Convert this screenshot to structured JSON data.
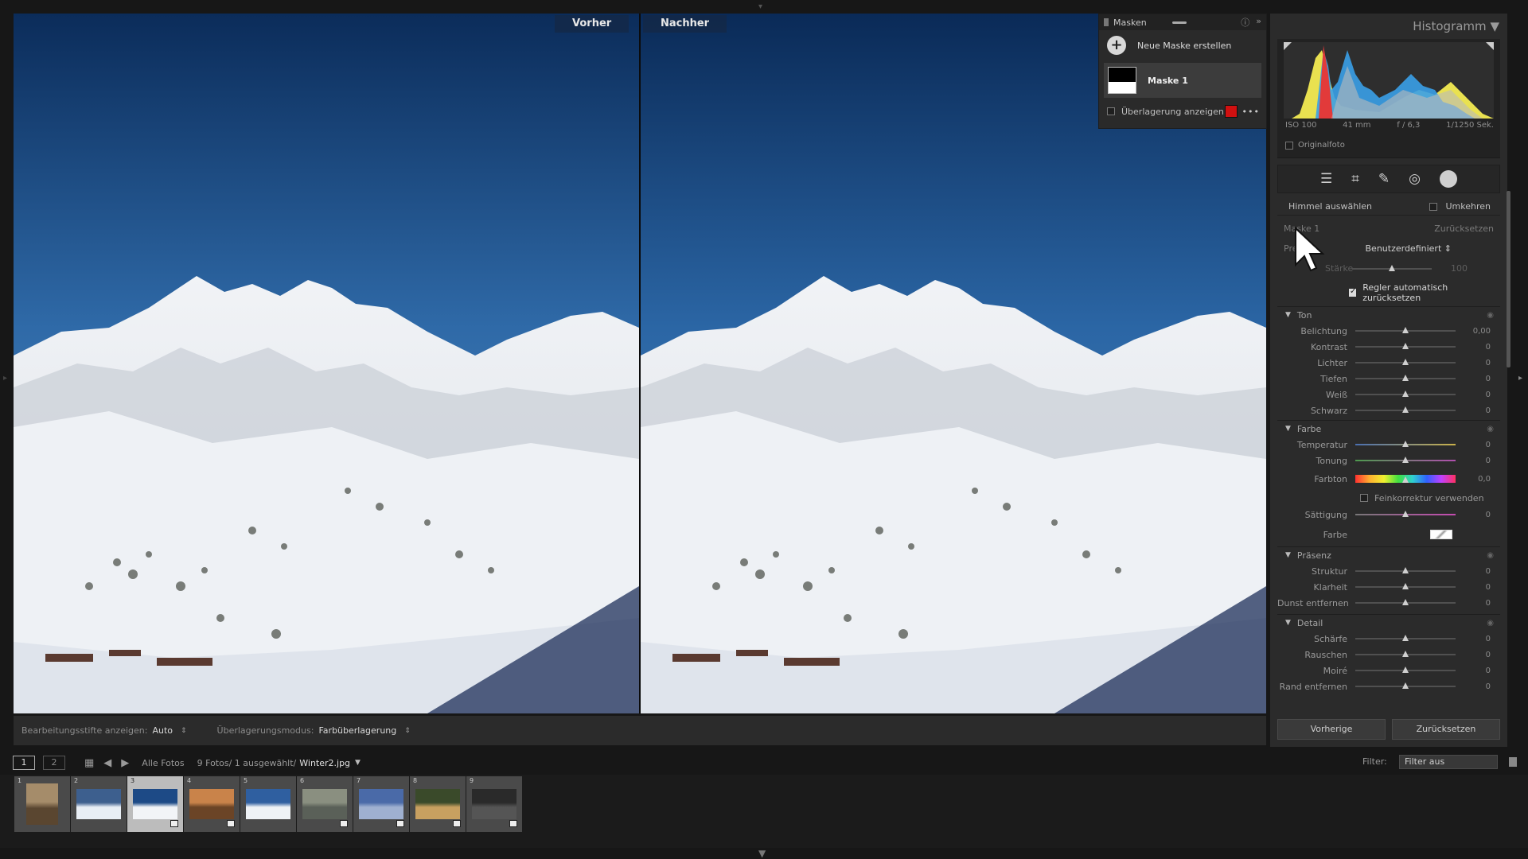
{
  "views": {
    "before_label": "Vorher",
    "after_label": "Nachher"
  },
  "masks_panel": {
    "title": "Masken",
    "new_mask_label": "Neue Maske erstellen",
    "mask_item": "Maske 1",
    "overlay_label": "Überlagerung anzeigen",
    "overlay_color": "#d01010"
  },
  "histogram": {
    "title": "Histogramm",
    "iso": "ISO 100",
    "focal": "41 mm",
    "aperture": "f / 6,3",
    "shutter": "1/1250 Sek.",
    "original_label": "Originalfoto"
  },
  "mask_settings": {
    "select_label": "Himmel auswählen",
    "invert_label": "Umkehren",
    "mask_name": "Maske 1",
    "reset_label": "Zurücksetzen",
    "preset_label": "Pre",
    "preset_value": "Benutzerdefiniert",
    "amount_label": "Stärke",
    "amount_value": "100",
    "auto_reset_label": "Regler automatisch zurücksetzen"
  },
  "sections": {
    "tone": {
      "title": "Ton",
      "sliders": [
        {
          "name": "Belichtung",
          "value": "0,00",
          "pos": 0.5
        },
        {
          "name": "Kontrast",
          "value": "0",
          "pos": 0.5
        },
        {
          "name": "Lichter",
          "value": "0",
          "pos": 0.5
        },
        {
          "name": "Tiefen",
          "value": "0",
          "pos": 0.5
        },
        {
          "name": "Weiß",
          "value": "0",
          "pos": 0.5
        },
        {
          "name": "Schwarz",
          "value": "0",
          "pos": 0.5
        }
      ]
    },
    "color": {
      "title": "Farbe",
      "temperature": {
        "name": "Temperatur",
        "value": "0",
        "pos": 0.5
      },
      "tint": {
        "name": "Tonung",
        "value": "0",
        "pos": 0.5
      },
      "hue": {
        "name": "Farbton",
        "value": "0,0",
        "pos": 0.5
      },
      "fine_label": "Feinkorrektur verwenden",
      "saturation": {
        "name": "Sättigung",
        "value": "0",
        "pos": 0.5
      },
      "color_label": "Farbe"
    },
    "presence": {
      "title": "Präsenz",
      "sliders": [
        {
          "name": "Struktur",
          "value": "0",
          "pos": 0.5
        },
        {
          "name": "Klarheit",
          "value": "0",
          "pos": 0.5
        },
        {
          "name": "Dunst entfernen",
          "value": "0",
          "pos": 0.5
        }
      ]
    },
    "detail": {
      "title": "Detail",
      "sliders": [
        {
          "name": "Schärfe",
          "value": "0",
          "pos": 0.5
        },
        {
          "name": "Rauschen",
          "value": "0",
          "pos": 0.5
        },
        {
          "name": "Moiré",
          "value": "0",
          "pos": 0.5
        },
        {
          "name": "Rand entfernen",
          "value": "0",
          "pos": 0.5
        }
      ]
    }
  },
  "panel_buttons": {
    "previous": "Vorherige",
    "reset": "Zurücksetzen"
  },
  "toolbar": {
    "pins_label": "Bearbeitungsstifte anzeigen:",
    "pins_value": "Auto",
    "overlay_mode_label": "Überlagerungsmodus:",
    "overlay_mode_value": "Farbüberlagerung"
  },
  "filmstrip_header": {
    "monitor1": "1",
    "monitor2": "2",
    "source": "Alle Fotos",
    "count": "9 Fotos/ 1 ausgewählt/",
    "filename": "Winter2.jpg",
    "filter_label": "Filter:",
    "filter_value": "Filter aus"
  },
  "filmstrip": [
    {
      "num": "1",
      "selected": false,
      "colors": [
        "#a58c6a",
        "#5a4630"
      ],
      "badge": false
    },
    {
      "num": "2",
      "selected": false,
      "colors": [
        "#3d5f8e",
        "#e8eef5"
      ],
      "badge": false
    },
    {
      "num": "3",
      "selected": true,
      "colors": [
        "#1d4a86",
        "#f2f4f7"
      ],
      "badge": true
    },
    {
      "num": "4",
      "selected": false,
      "colors": [
        "#c9834a",
        "#6b4426"
      ],
      "badge": true
    },
    {
      "num": "5",
      "selected": false,
      "colors": [
        "#2f5fa0",
        "#eef2f6"
      ],
      "badge": false
    },
    {
      "num": "6",
      "selected": false,
      "colors": [
        "#8a8f80",
        "#5a6058"
      ],
      "badge": true
    },
    {
      "num": "7",
      "selected": false,
      "colors": [
        "#4a6aa8",
        "#9fb0d0"
      ],
      "badge": true
    },
    {
      "num": "8",
      "selected": false,
      "colors": [
        "#3a4a2a",
        "#c8a060"
      ],
      "badge": true
    },
    {
      "num": "9",
      "selected": false,
      "colors": [
        "#2a2a2a",
        "#555555"
      ],
      "badge": true
    }
  ]
}
